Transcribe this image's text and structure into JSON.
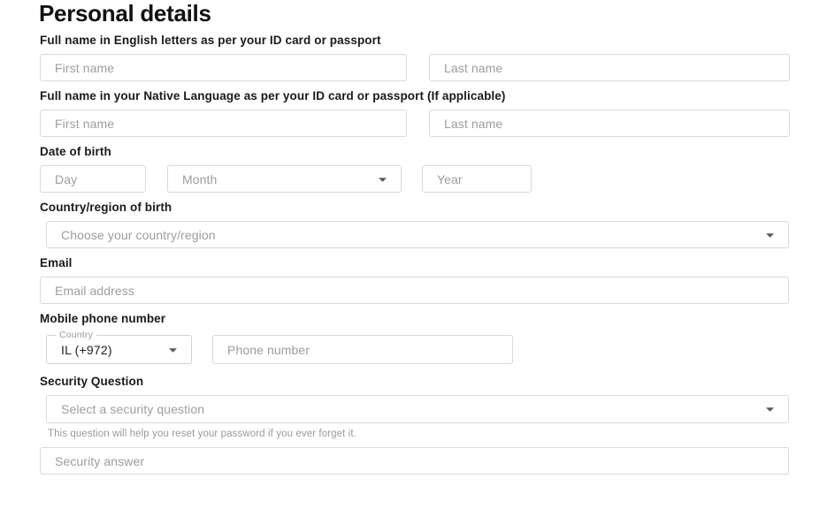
{
  "page": {
    "title": "Personal details"
  },
  "icons": {
    "dropdown": "chevron-down-icon"
  },
  "sections": {
    "english_name": {
      "label": "Full name in English letters as per your ID card or passport",
      "first_name_placeholder": "First name",
      "last_name_placeholder": "Last name"
    },
    "native_name": {
      "label": "Full name in your Native Language as per your ID card or passport (If applicable)",
      "first_name_placeholder": "First name",
      "last_name_placeholder": "Last name"
    },
    "date_of_birth": {
      "label": "Date of birth",
      "day_placeholder": "Day",
      "month_placeholder": "Month",
      "year_placeholder": "Year"
    },
    "country_of_birth": {
      "label": "Country/region of birth",
      "placeholder": "Choose your country/region"
    },
    "email": {
      "label": "Email",
      "placeholder": "Email address"
    },
    "mobile_phone": {
      "label": "Mobile phone number",
      "country_legend": "Country",
      "country_value": "IL (+972)",
      "phone_placeholder": "Phone number"
    },
    "security_question": {
      "label": "Security Question",
      "placeholder": "Select a security question",
      "helper": "This question will help you reset your password if you ever forget it.",
      "answer_placeholder": "Security answer"
    }
  },
  "colors": {
    "text": "#1a1a1a",
    "placeholder": "#9d9d9d",
    "border": "#dadada",
    "helper": "#9a9a9a"
  }
}
